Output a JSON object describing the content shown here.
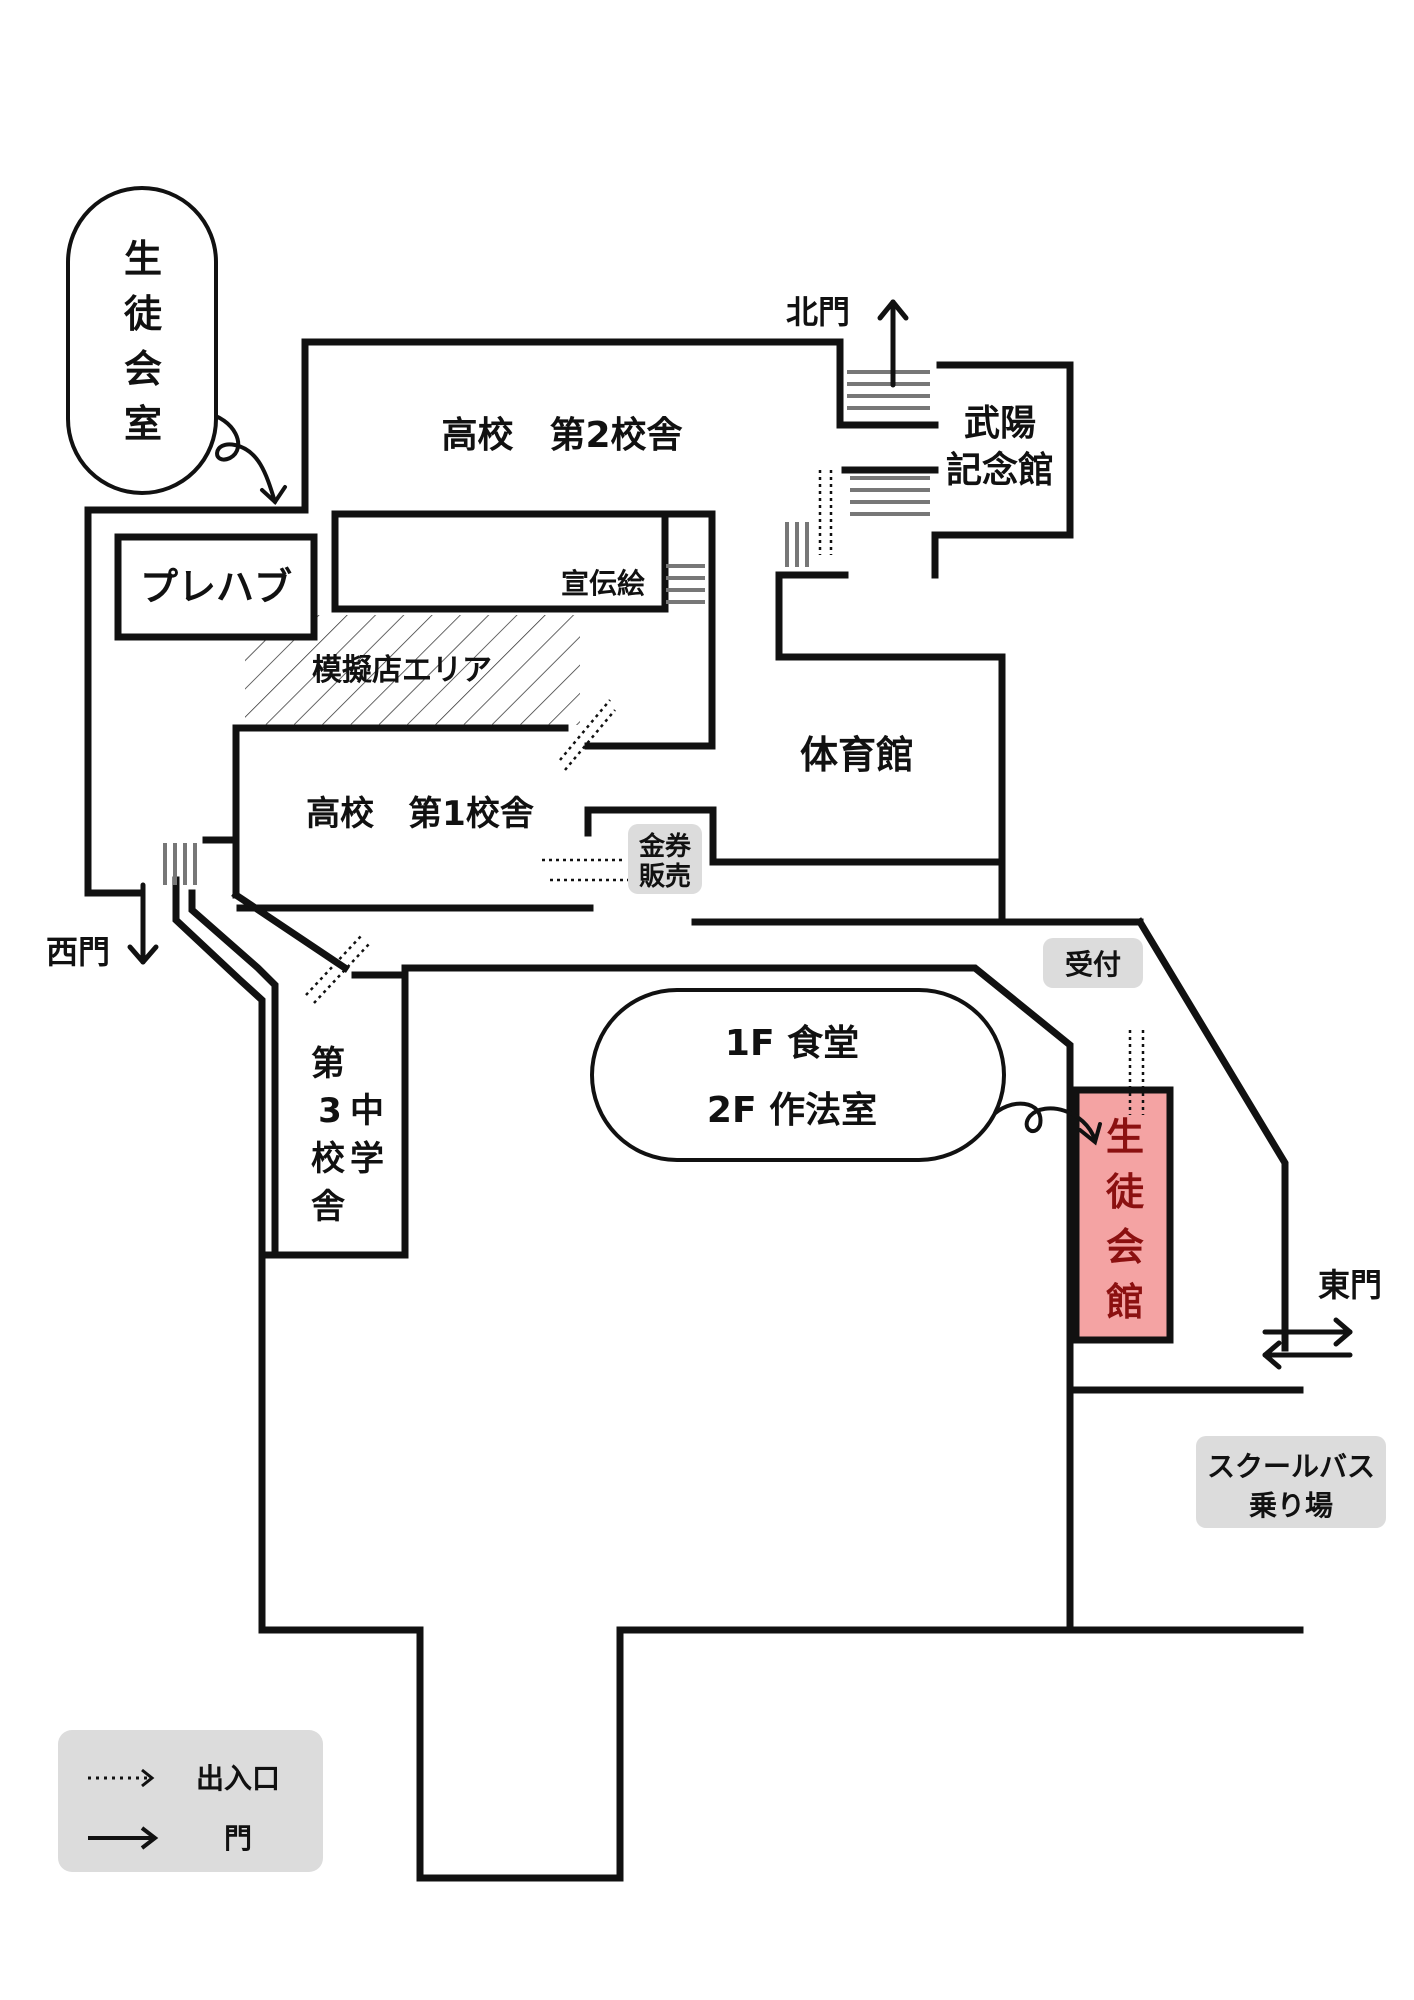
{
  "buildings": {
    "hs2": "高校　第2校舎",
    "hs1": "高校　第1校舎",
    "prefab": "プレハブ",
    "mock_area": "模擬店エリア",
    "promo_art": "宣伝絵",
    "gym": "体育館",
    "takeyo_line1": "武陽",
    "takeyo_line2": "記念館",
    "ticket_line1": "金券",
    "ticket_line2": "販売",
    "reception": "受付",
    "cafeteria_1f": "1F 食堂",
    "etiquette_2f": "2F  作法室",
    "bus_line1": "スクールバス",
    "bus_line2": "乗り場"
  },
  "vertical": {
    "student_room": [
      "生",
      "徒",
      "会",
      "室"
    ],
    "student_hall": [
      "生",
      "徒",
      "会",
      "館"
    ],
    "jhs3_col1": [
      "第",
      "中",
      "学"
    ],
    "jhs3_col2": [
      "3",
      "校",
      "舎"
    ]
  },
  "gates": {
    "north": "北門",
    "west": "西門",
    "east": "東門"
  },
  "legend": {
    "entrance": "出入口",
    "gate": "門"
  },
  "colors": {
    "walls": "#111111",
    "highlight_fill": "#f4a3a3",
    "highlight_text": "#8b1010",
    "label_box": "#dcdcdc"
  }
}
